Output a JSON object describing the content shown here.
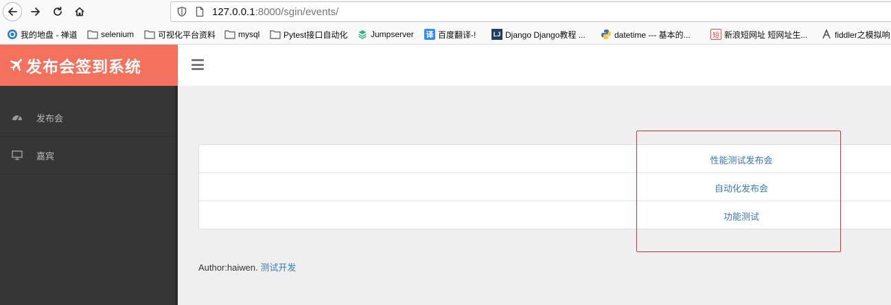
{
  "browser": {
    "url_host": "127.0.0.1",
    "url_rest": ":8000/sgin/events/",
    "bookmarks": [
      {
        "label": "我的地盘 - 禅道",
        "icon": "zentao-icon"
      },
      {
        "label": "selenium",
        "icon": "folder-icon"
      },
      {
        "label": "可视化平台资料",
        "icon": "folder-icon"
      },
      {
        "label": "mysql",
        "icon": "folder-icon"
      },
      {
        "label": "Pytest接口自动化",
        "icon": "folder-icon"
      },
      {
        "label": "Jumpserver",
        "icon": "jumpserver-icon"
      },
      {
        "label": "百度翻译-!",
        "icon": "translate-icon"
      },
      {
        "label": "Django Django教程 ...",
        "icon": "django-icon"
      },
      {
        "label": "datetime --- 基本的...",
        "icon": "python-icon"
      },
      {
        "label": "新浪短网址 短网址生...",
        "icon": "short-url-icon"
      },
      {
        "label": "fiddler之模拟响",
        "icon": "fiddler-icon"
      }
    ],
    "short_icon_text": "短",
    "translate_icon_text": "译",
    "django_icon_text": "LJ"
  },
  "app": {
    "brand": "发布会签到系统",
    "brand_color": "#f4715d",
    "sidebar": [
      {
        "label": "发布会",
        "icon": "dashboard-icon"
      },
      {
        "label": "嘉宾",
        "icon": "monitor-icon"
      }
    ],
    "events": [
      "性能测试发布会",
      "自动化发布会",
      "功能测试"
    ],
    "footer_prefix": "Author:haiwen. ",
    "footer_link": "测试开发",
    "link_color": "#3a79b0",
    "highlight_color": "#d92f2f"
  }
}
